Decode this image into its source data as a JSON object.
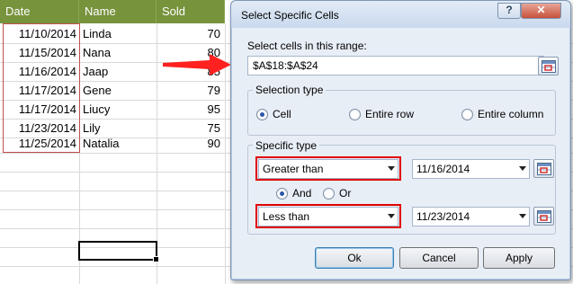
{
  "sheet": {
    "headers": [
      "Date",
      "Name",
      "Sold"
    ],
    "rows": [
      {
        "date": "11/10/2014",
        "name": "Linda",
        "sold": "70"
      },
      {
        "date": "11/15/2014",
        "name": "Nana",
        "sold": "80"
      },
      {
        "date": "11/16/2014",
        "name": "Jaap",
        "sold": "85"
      },
      {
        "date": "11/17/2014",
        "name": "Gene",
        "sold": "79"
      },
      {
        "date": "11/17/2014",
        "name": "Liucy",
        "sold": "95"
      },
      {
        "date": "11/23/2014",
        "name": "Lily",
        "sold": "75"
      },
      {
        "date": "11/25/2014",
        "name": "Natalia",
        "sold": "90"
      }
    ],
    "header_color": "#77933c"
  },
  "dialog": {
    "title": "Select Specific Cells",
    "help_label": "?",
    "close_label": "✕",
    "range_label": "Select cells in this range:",
    "range_value": "$A$18:$A$24",
    "selection_type": {
      "title": "Selection type",
      "options": [
        "Cell",
        "Entire row",
        "Entire column"
      ],
      "selected": "Cell"
    },
    "specific_type": {
      "title": "Specific type",
      "condition1": {
        "operator": "Greater than",
        "value": "11/16/2014"
      },
      "logic": {
        "options": [
          "And",
          "Or"
        ],
        "selected": "And"
      },
      "condition2": {
        "operator": "Less than",
        "value": "11/23/2014"
      }
    },
    "buttons": {
      "ok": "Ok",
      "cancel": "Cancel",
      "apply": "Apply"
    },
    "highlight_color": "#e10000",
    "arrow_color": "#ff2020"
  }
}
